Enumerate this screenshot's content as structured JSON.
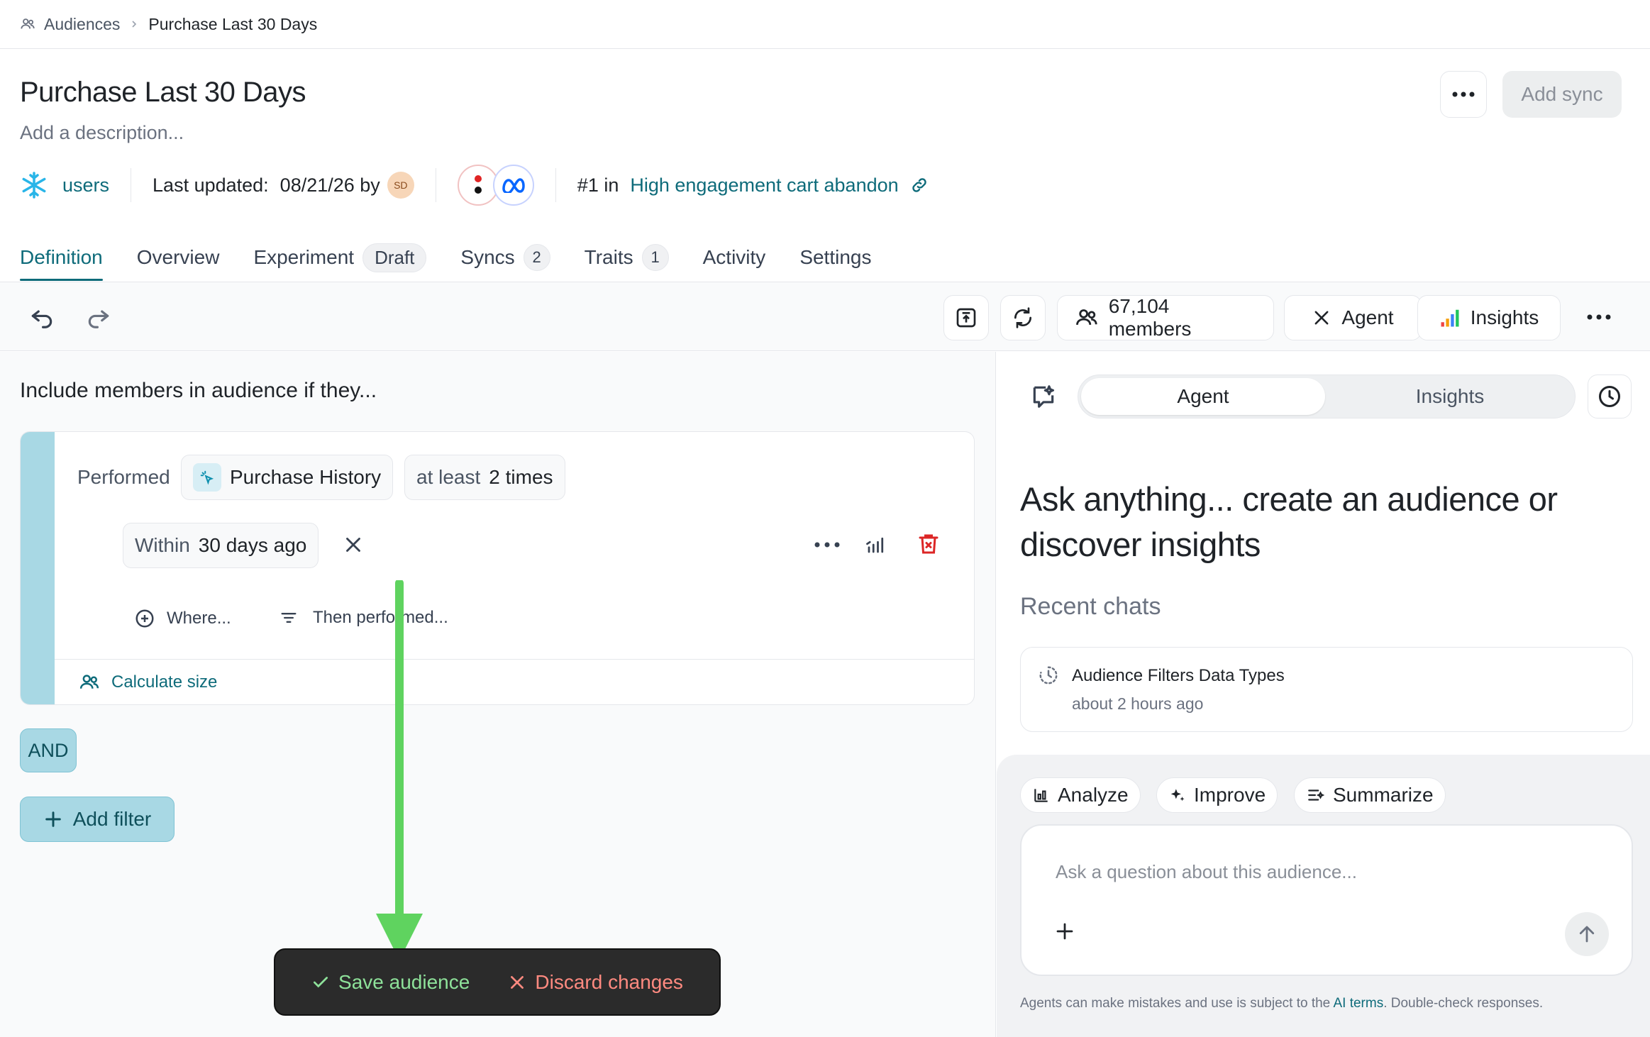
{
  "breadcrumb": {
    "root": "Audiences",
    "current": "Purchase Last 30 Days"
  },
  "header": {
    "title": "Purchase Last 30 Days",
    "description_placeholder": "Add a description...",
    "add_sync": "Add sync"
  },
  "meta": {
    "source": "users",
    "last_updated_label": "Last updated:",
    "last_updated_value": "08/21/26 by",
    "avatar_initials": "SD",
    "rank_prefix": "#1 in",
    "rank_link": "High engagement cart abandon"
  },
  "tabs": [
    {
      "label": "Definition"
    },
    {
      "label": "Overview"
    },
    {
      "label": "Experiment",
      "badge": "Draft"
    },
    {
      "label": "Syncs",
      "count": "2"
    },
    {
      "label": "Traits",
      "count": "1"
    },
    {
      "label": "Activity"
    },
    {
      "label": "Settings"
    }
  ],
  "toolbar": {
    "members": "67,104 members",
    "agent": "Agent",
    "insights": "Insights"
  },
  "definition": {
    "heading": "Include members in audience if they...",
    "performed": "Performed",
    "event": "Purchase History",
    "frequency_prefix": "at least",
    "frequency_value": "2 times",
    "window_prefix": "Within",
    "window_value": "30 days ago",
    "where": "Where...",
    "then_performed": "Then performed...",
    "calculate_size": "Calculate size",
    "and": "AND",
    "add_filter": "Add filter"
  },
  "savebar": {
    "save": "Save audience",
    "discard": "Discard changes"
  },
  "agent_panel": {
    "seg_agent": "Agent",
    "seg_insights": "Insights",
    "hero": "Ask anything... create an audience or discover insights",
    "recent_label": "Recent chats",
    "recent_chats": [
      {
        "title": "Audience Filters Data Types",
        "time": "about 2 hours ago"
      }
    ],
    "suggestions": {
      "analyze": "Analyze",
      "improve": "Improve",
      "summarize": "Summarize"
    },
    "input_placeholder": "Ask a question about this audience...",
    "disclaimer_pre": "Agents can make mistakes and use is subject to the ",
    "disclaimer_link": "AI terms",
    "disclaimer_post": ". Double-check responses."
  },
  "colors": {
    "accent": "#0e6b7a",
    "filter_bar": "#a8d8e4",
    "save_green": "#8ee29a",
    "discard_red": "#ff8a80",
    "arrow_green": "#5fd35f"
  }
}
